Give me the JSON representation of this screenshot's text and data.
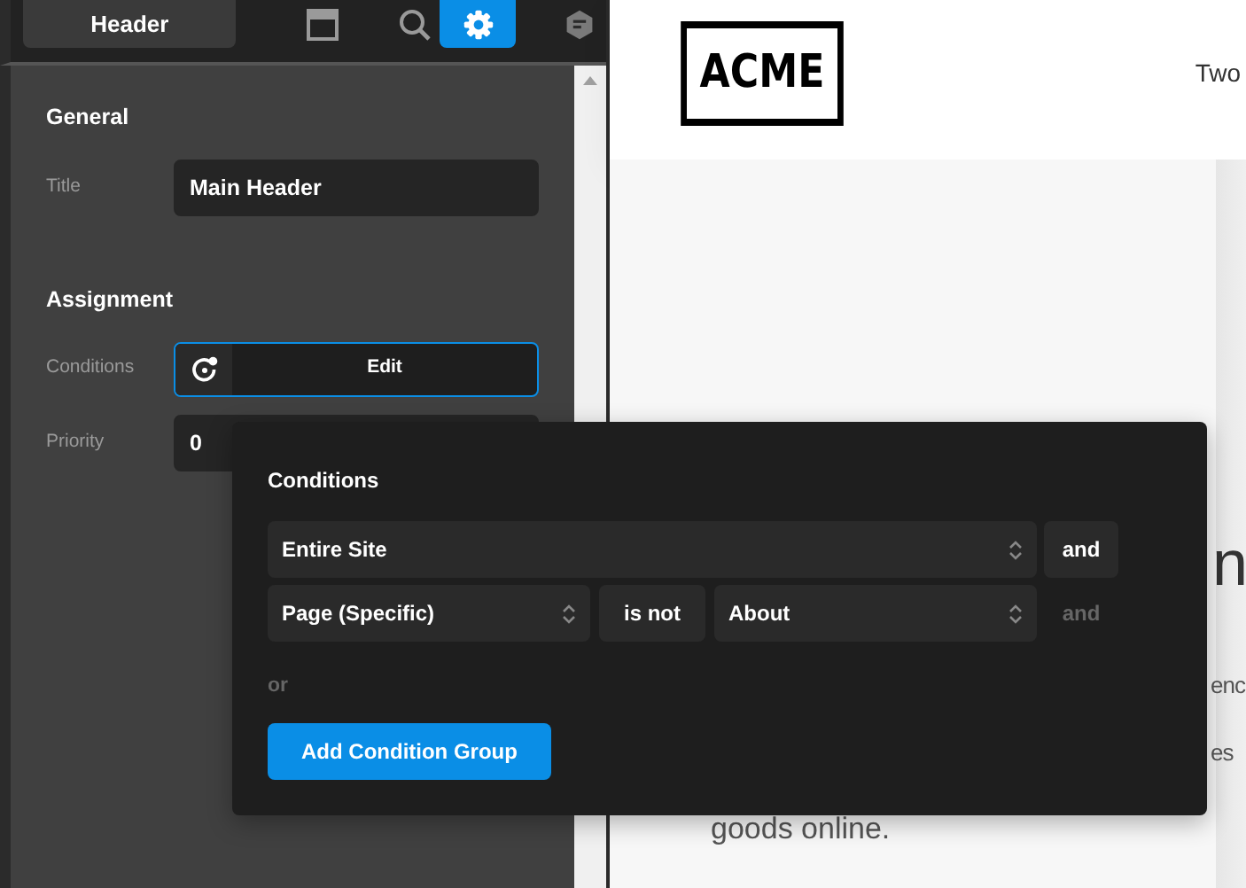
{
  "toolbar": {
    "tabs": [
      {
        "kind": "label",
        "label": "Header",
        "selected": false
      },
      {
        "kind": "layout",
        "selected": false
      },
      {
        "kind": "search",
        "selected": false
      },
      {
        "kind": "settings",
        "selected": true
      },
      {
        "kind": "hexagon",
        "selected": false
      }
    ]
  },
  "sections": [
    {
      "title": "General",
      "fields": [
        {
          "kind": "text",
          "label": "Title",
          "value": "Main Header"
        }
      ]
    },
    {
      "title": "Assignment",
      "fields": [
        {
          "kind": "button",
          "label": "Conditions",
          "value": "Edit",
          "focused": true
        },
        {
          "kind": "text",
          "label": "Priority",
          "value": "0"
        }
      ]
    }
  ],
  "preview": {
    "logo": "ACME",
    "nav_text": "Two",
    "hero_heading": "n",
    "hero_lines": [
      "enc",
      "es"
    ],
    "hero_tail": "goods online."
  },
  "conditions": {
    "title": "Conditions",
    "rows": [
      {
        "parts": [
          {
            "kind": "select",
            "text": "Entire Site"
          }
        ],
        "joiner": {
          "text": "and",
          "active": true
        }
      },
      {
        "parts": [
          {
            "kind": "select",
            "text": "Page (Specific)"
          },
          {
            "kind": "operator",
            "text": "is not"
          },
          {
            "kind": "select",
            "text": "About"
          }
        ],
        "joiner": {
          "text": "and",
          "active": false
        }
      }
    ],
    "separator": "or",
    "add_button": "Add Condition Group"
  }
}
